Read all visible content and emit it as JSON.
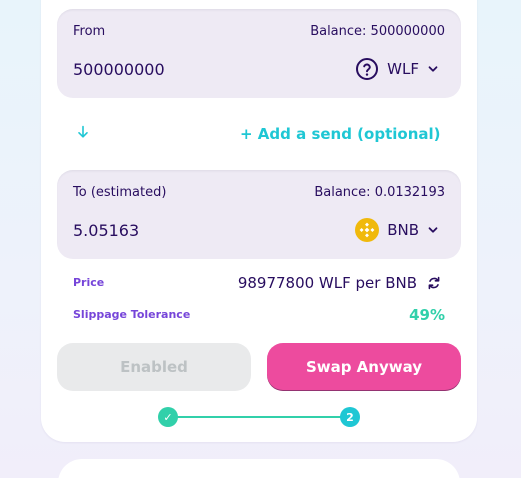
{
  "from": {
    "label": "From",
    "balance": "Balance: 500000000",
    "amount": "500000000",
    "token": {
      "symbol": "WLF",
      "icon": "help-circle-icon"
    }
  },
  "to": {
    "label": "To (estimated)",
    "balance": "Balance: 0.0132193",
    "amount": "5.05163",
    "token": {
      "symbol": "BNB",
      "icon": "bnb-icon"
    }
  },
  "add_send": "+ Add a send (optional)",
  "price": {
    "label": "Price",
    "value": "98977800 WLF per BNB"
  },
  "slippage": {
    "label": "Slippage Tolerance",
    "value": "49%"
  },
  "buttons": {
    "enabled": "Enabled",
    "swap": "Swap Anyway"
  },
  "stepper": {
    "step1": "✓",
    "step2": "2"
  },
  "colors": {
    "primary": "#1fc7d4",
    "accent": "#ed4b9e",
    "success": "#31d0aa",
    "text": "#280d5f",
    "secondary": "#7645d9",
    "bnb": "#f0b90b"
  }
}
